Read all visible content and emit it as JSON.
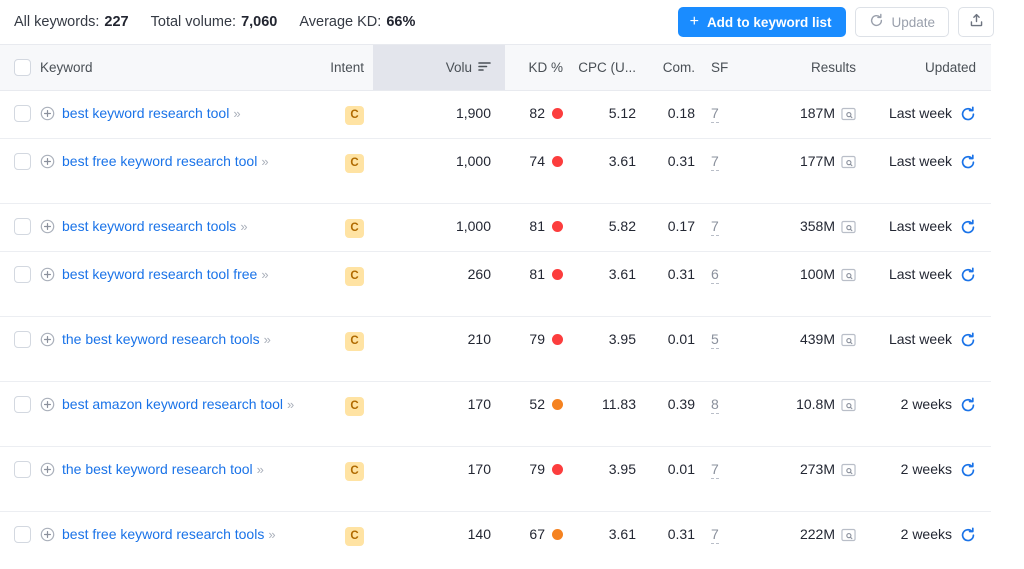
{
  "summary": {
    "all_keywords_label": "All keywords:",
    "all_keywords_value": "227",
    "total_volume_label": "Total volume:",
    "total_volume_value": "7,060",
    "average_kd_label": "Average KD:",
    "average_kd_value": "66%"
  },
  "toolbar": {
    "add_to_list_label": "Add to keyword list",
    "add_plus": "+",
    "update_label": "Update",
    "export_icon": "export-icon"
  },
  "columns": {
    "keyword": "Keyword",
    "intent": "Intent",
    "volume": "Volu",
    "kd": "KD %",
    "cpc": "CPC (U...",
    "com": "Com.",
    "sf": "SF",
    "results": "Results",
    "updated": "Updated"
  },
  "sort": {
    "column": "volume",
    "direction": "desc"
  },
  "colors": {
    "accent_blue": "#1a8cff",
    "link_blue": "#1a73e8",
    "kd_red": "#fc3d3d",
    "kd_orange": "#f58220",
    "intent_bg": "#ffe3a3",
    "intent_fg": "#b06a00",
    "header_bg": "#f7f8fa",
    "sorted_header_bg": "#e3e5ec"
  },
  "rows": [
    {
      "keyword": "best keyword research tool",
      "intent": "C",
      "volume": "1,900",
      "kd": "82",
      "kd_color": "#fc3d3d",
      "cpc": "5.12",
      "com": "0.18",
      "sf": "7",
      "results": "187M",
      "updated": "Last week",
      "lines": 1
    },
    {
      "keyword": "best free keyword research tool",
      "intent": "C",
      "volume": "1,000",
      "kd": "74",
      "kd_color": "#fc3d3d",
      "cpc": "3.61",
      "com": "0.31",
      "sf": "7",
      "results": "177M",
      "updated": "Last week",
      "lines": 2
    },
    {
      "keyword": "best keyword research tools",
      "intent": "C",
      "volume": "1,000",
      "kd": "81",
      "kd_color": "#fc3d3d",
      "cpc": "5.82",
      "com": "0.17",
      "sf": "7",
      "results": "358M",
      "updated": "Last week",
      "lines": 1
    },
    {
      "keyword": "best keyword research tool free",
      "intent": "C",
      "volume": "260",
      "kd": "81",
      "kd_color": "#fc3d3d",
      "cpc": "3.61",
      "com": "0.31",
      "sf": "6",
      "results": "100M",
      "updated": "Last week",
      "lines": 2
    },
    {
      "keyword": "the best keyword research tools",
      "intent": "C",
      "volume": "210",
      "kd": "79",
      "kd_color": "#fc3d3d",
      "cpc": "3.95",
      "com": "0.01",
      "sf": "5",
      "results": "439M",
      "updated": "Last week",
      "lines": 2
    },
    {
      "keyword": "best amazon keyword research tool",
      "intent": "C",
      "volume": "170",
      "kd": "52",
      "kd_color": "#f58220",
      "cpc": "11.83",
      "com": "0.39",
      "sf": "8",
      "results": "10.8M",
      "updated": "2 weeks",
      "lines": 2
    },
    {
      "keyword": "the best keyword research tool",
      "intent": "C",
      "volume": "170",
      "kd": "79",
      "kd_color": "#fc3d3d",
      "cpc": "3.95",
      "com": "0.01",
      "sf": "7",
      "results": "273M",
      "updated": "2 weeks",
      "lines": 2
    },
    {
      "keyword": "best free keyword research tools",
      "intent": "C",
      "volume": "140",
      "kd": "67",
      "kd_color": "#f58220",
      "cpc": "3.61",
      "com": "0.31",
      "sf": "7",
      "results": "222M",
      "updated": "2 weeks",
      "lines": 2
    }
  ]
}
